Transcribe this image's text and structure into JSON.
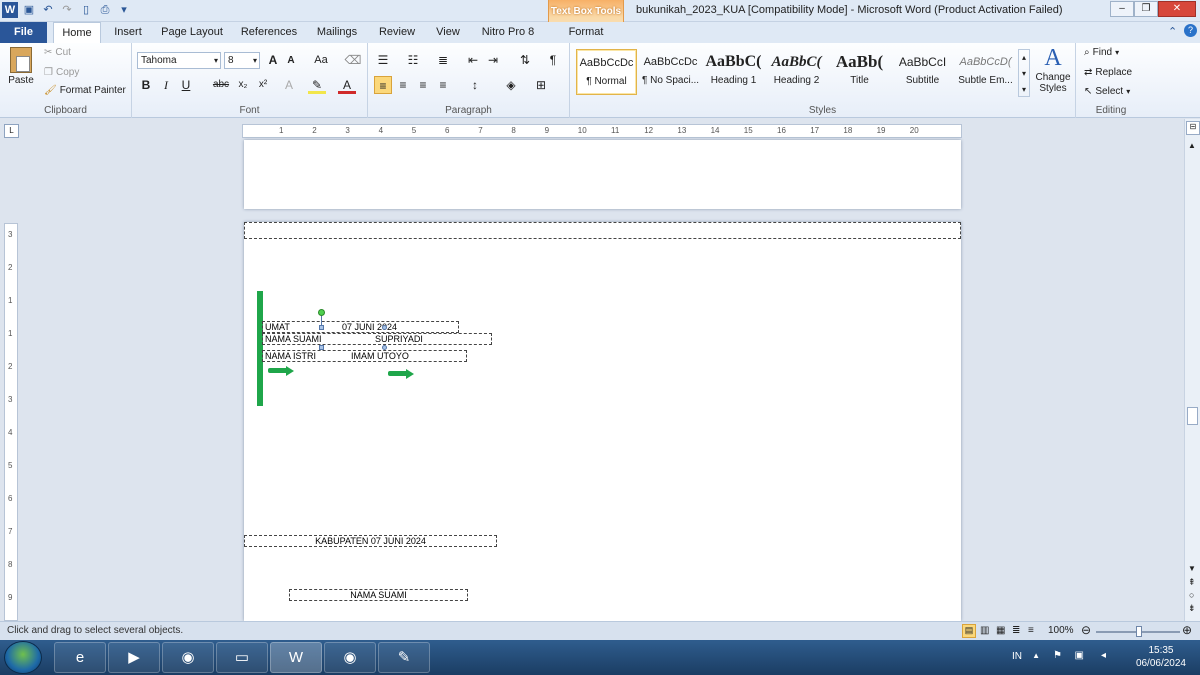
{
  "title_bar": {
    "document_title": "bukunikah_2023_KUA [Compatibility Mode]  -  Microsoft Word (Product Activation Failed)",
    "contextual_tab_group": "Text Box Tools",
    "quick_access": [
      "word-app-icon",
      "save-icon",
      "undo-icon",
      "redo-icon",
      "new-doc-icon",
      "print-preview-icon",
      "customize-icon"
    ],
    "window_buttons": {
      "minimize": "–",
      "restore": "❐",
      "close": "✕"
    }
  },
  "tabs": [
    "File",
    "Home",
    "Insert",
    "Page Layout",
    "References",
    "Mailings",
    "Review",
    "View",
    "Nitro Pro 8",
    "Format"
  ],
  "ribbon": {
    "clipboard": {
      "label": "Clipboard",
      "paste": "Paste",
      "cut": "Cut",
      "copy": "Copy",
      "format_painter": "Format Painter"
    },
    "font": {
      "label": "Font",
      "font_name": "Tahoma",
      "font_size": "8",
      "bold": "B",
      "italic": "I",
      "underline": "U",
      "strike": "abc",
      "subscript": "x₂",
      "superscript": "x²",
      "grow": "A",
      "shrink": "A",
      "change_case": "Aa"
    },
    "paragraph": {
      "label": "Paragraph",
      "pilcrow": "¶"
    },
    "styles": {
      "label": "Styles",
      "items": [
        {
          "sample": "AaBbCcDc",
          "name": "¶ Normal"
        },
        {
          "sample": "AaBbCcDc",
          "name": "¶ No Spaci..."
        },
        {
          "sample": "AaBbC(",
          "name": "Heading 1"
        },
        {
          "sample": "AaBbC(",
          "name": "Heading 2"
        },
        {
          "sample": "AaBb(",
          "name": "Title"
        },
        {
          "sample": "AaBbCcI",
          "name": "Subtitle"
        },
        {
          "sample": "AaBbCcD(",
          "name": "Subtle Em..."
        }
      ],
      "change_styles": "Change Styles"
    },
    "editing": {
      "label": "Editing",
      "find": "Find",
      "replace": "Replace",
      "select": "Select"
    }
  },
  "ruler": {
    "horizontal_marks": [
      "1",
      "2",
      "3",
      "4",
      "5",
      "6",
      "7",
      "8",
      "9",
      "10",
      "11",
      "12",
      "13",
      "14",
      "15",
      "16",
      "17",
      "18",
      "19",
      "20"
    ],
    "vertical_marks": [
      "3",
      "2",
      "1",
      "1",
      "2",
      "3",
      "4",
      "5",
      "6",
      "7",
      "8",
      "9"
    ]
  },
  "document": {
    "boxes": {
      "umat_label": "UMAT",
      "umat_value": "07 JUNI 2024",
      "suami_label": "NAMA SUAMI",
      "suami_value": "SUPRIYADI",
      "istri_label": "NAMA ISTRI",
      "istri_value": "IMAM UTOYO",
      "kabupaten": "KABUPATEN 07 JUNI 2024",
      "nama_suami_footer": "NAMA SUAMI"
    },
    "annotation_color": "#1fa64a"
  },
  "status_bar": {
    "message": "Click and drag to select several objects.",
    "zoom": "100%"
  },
  "taskbar": {
    "apps": [
      "ie-icon",
      "media-player-icon",
      "chrome-icon",
      "file-explorer-icon",
      "word-icon",
      "chrome-icon",
      "paint-icon"
    ],
    "lang": "IN",
    "time": "15:35",
    "date": "06/06/2024"
  }
}
